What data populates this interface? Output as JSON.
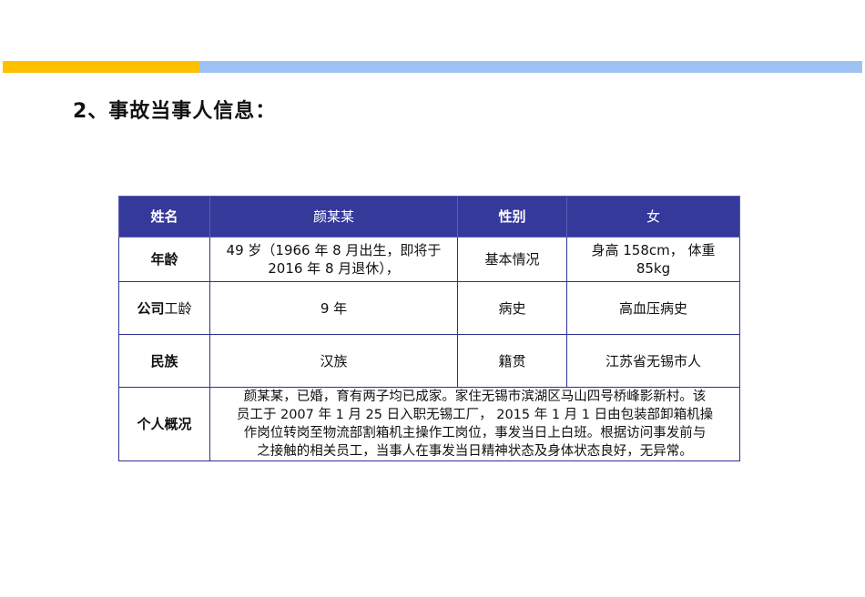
{
  "heading": "2、事故当事人信息：",
  "table": {
    "header": {
      "name_label": "姓名",
      "name_value": "颜某某",
      "gender_label": "性别",
      "gender_value": "女"
    },
    "row_age": {
      "label": "年龄",
      "value_line1": "49 岁（1966 年 8 月出生，即将于",
      "value_line2": "2016 年 8 月退休），",
      "info_label": "基本情况",
      "info_value_line1": "身高 158cm， 体重",
      "info_value_line2": "85kg"
    },
    "row_tenure": {
      "label_bold": "公司",
      "label_normal": "工龄",
      "value": "9 年",
      "history_label": "病史",
      "history_value": "高血压病史"
    },
    "row_ethnicity": {
      "label": "民族",
      "value": "汉族",
      "origin_label": "籍贯",
      "origin_value": "江苏省无锡市人"
    },
    "row_profile": {
      "label": "个人概况",
      "text_line1": "颜某某，已婚，育有两子均已成家。家住无锡市滨湖区马山四号桥峰影新村。该",
      "text_line2": "员工于 2007 年 1 月 25 日入职无锡工厂， 2015 年 1 月 1 日由包装部卸箱机操",
      "text_line3": "作岗位转岗至物流部割箱机主操作工岗位，事发当日上白班。根据访问事发前与",
      "text_line4": "之接触的相关员工，当事人在事发当日精神状态及身体状态良好，无异常。"
    }
  }
}
